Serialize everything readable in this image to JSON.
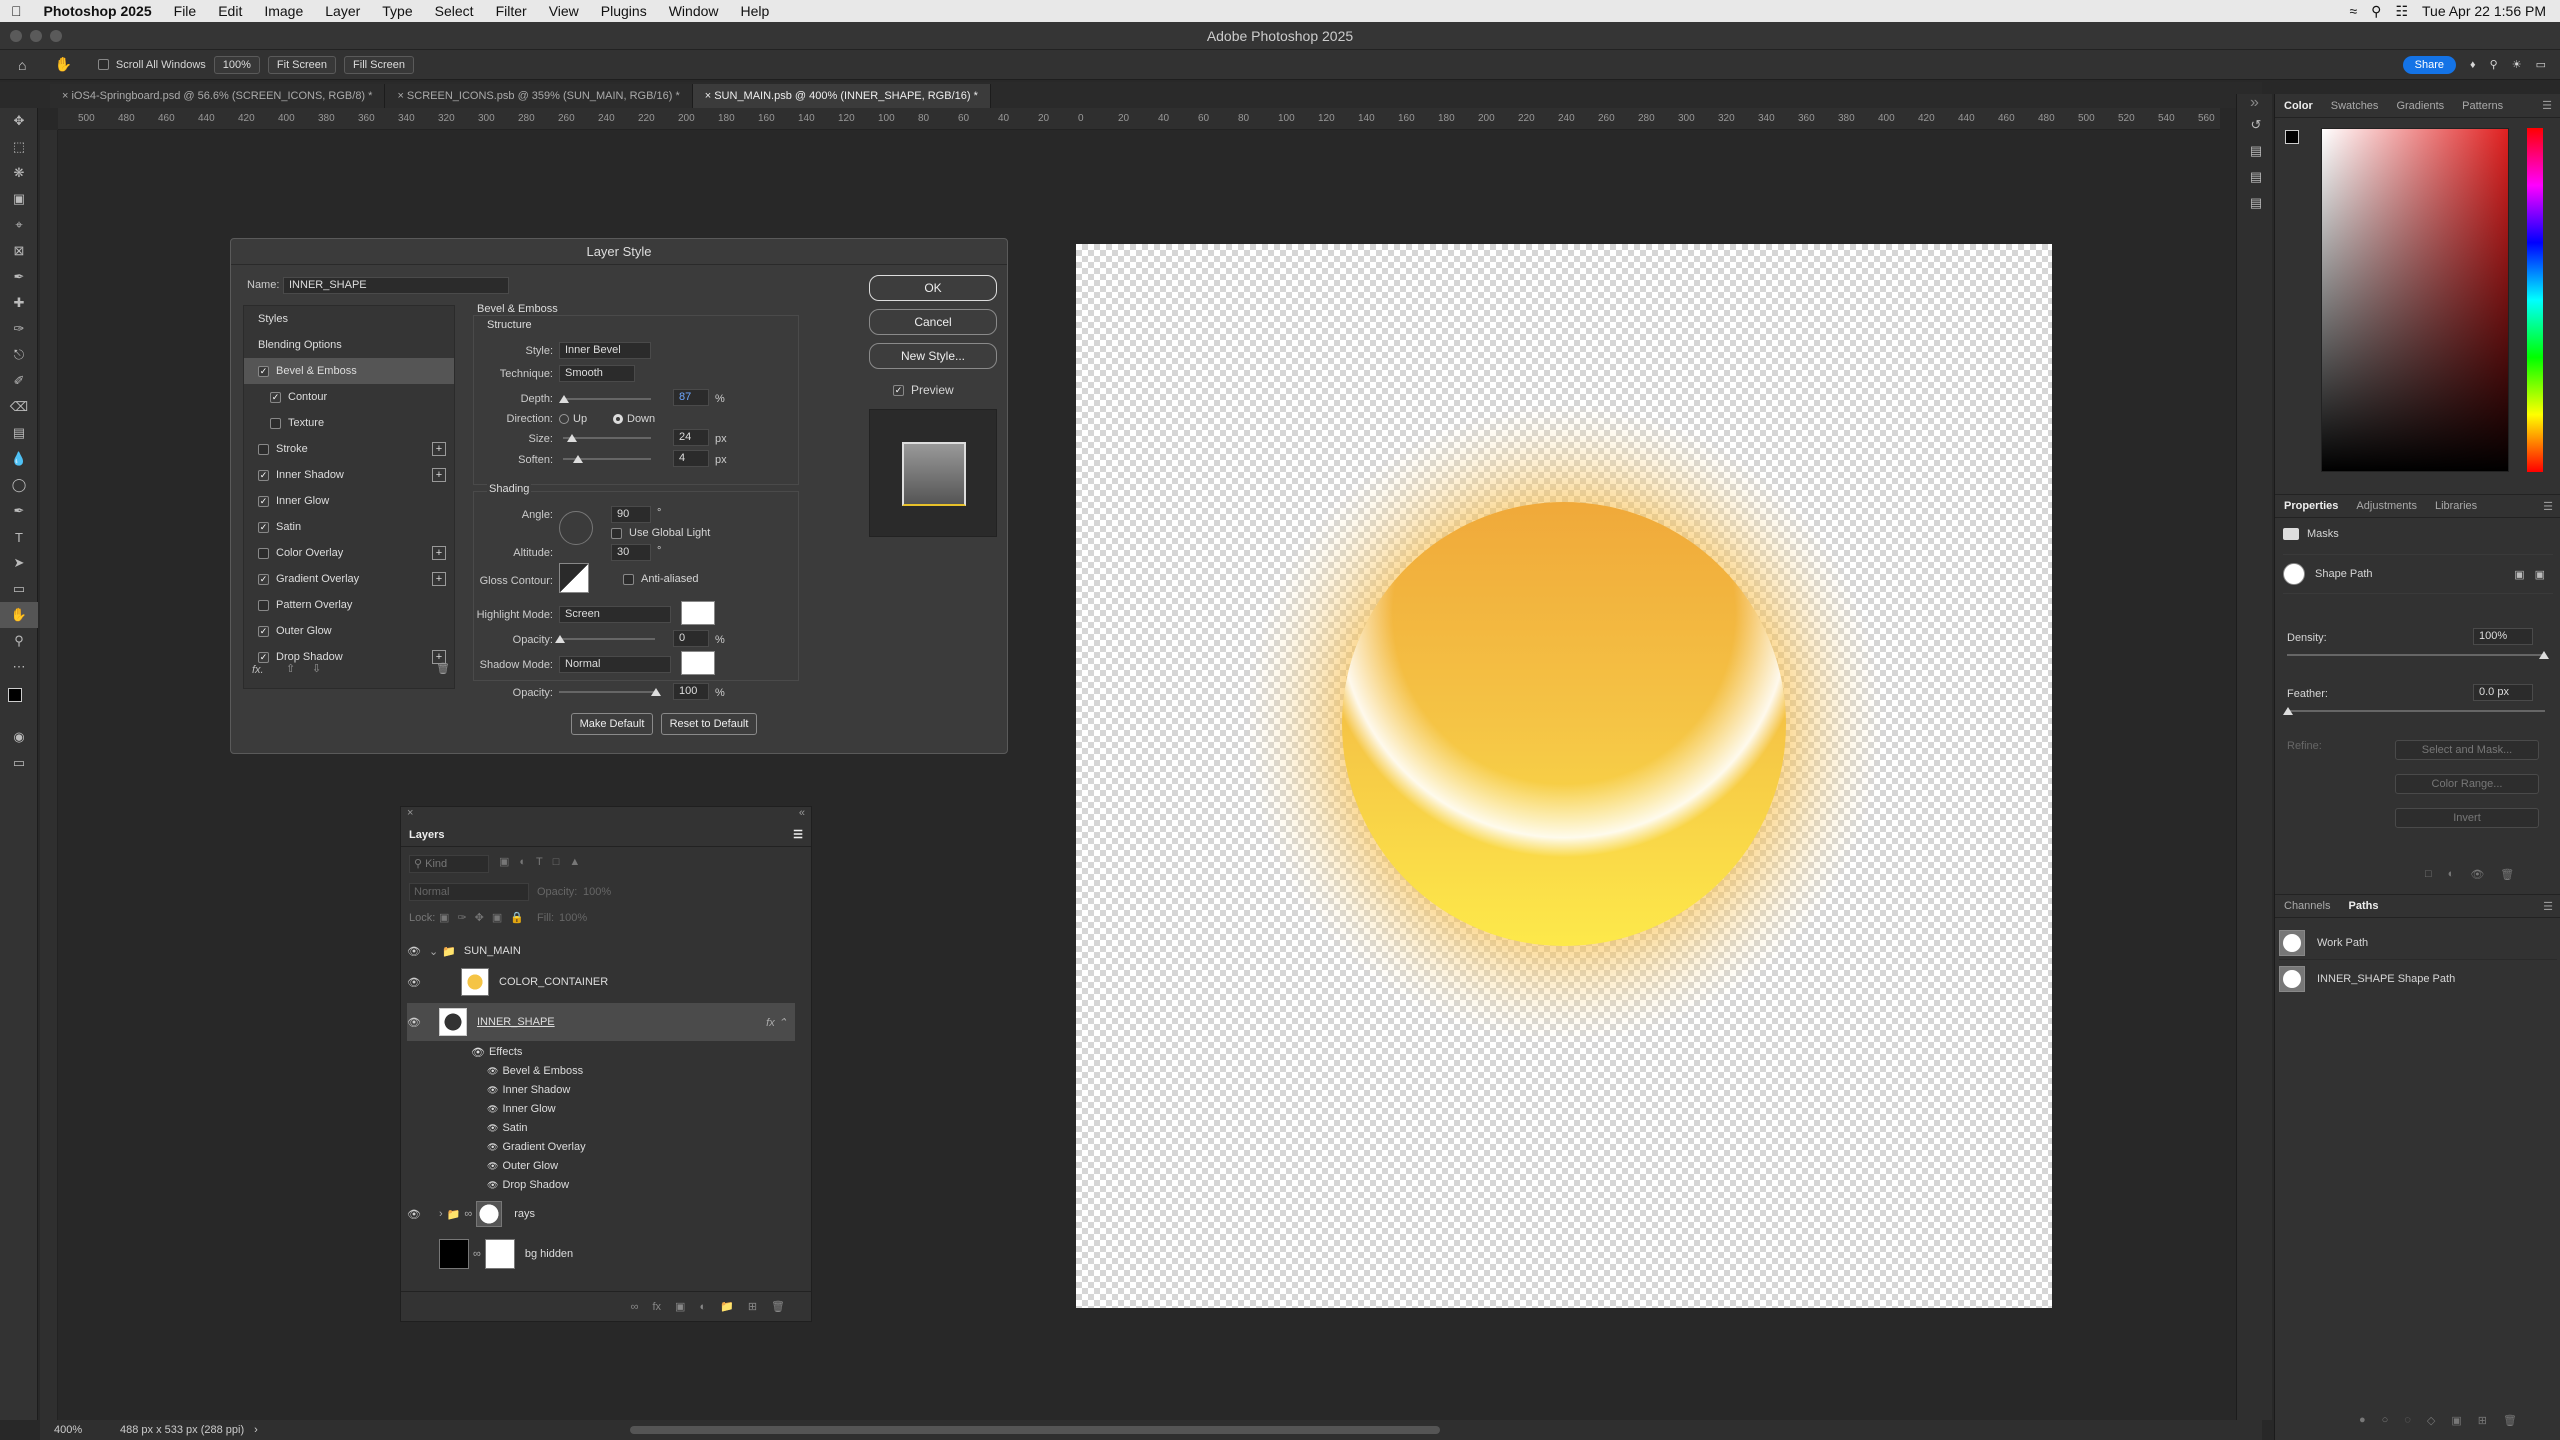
{
  "menubar": {
    "apple": "",
    "app": "Photoshop 2025",
    "items": [
      "File",
      "Edit",
      "Image",
      "Layer",
      "Type",
      "Select",
      "Filter",
      "View",
      "Plugins",
      "Window",
      "Help"
    ],
    "clock": "Tue Apr 22  1:56 PM"
  },
  "window": {
    "title": "Adobe Photoshop 2025",
    "share": "Share"
  },
  "options": {
    "scroll_all": "Scroll All Windows",
    "zoom": "100%",
    "fit": "Fit Screen",
    "fill": "Fill Screen"
  },
  "tabs": [
    {
      "label": "iOS4-Springboard.psd @ 56.6% (SCREEN_ICONS, RGB/8) *"
    },
    {
      "label": "SCREEN_ICONS.psb @ 359% (SUN_MAIN, RGB/16) *"
    },
    {
      "label": "SUN_MAIN.psb @ 400% (INNER_SHAPE, RGB/16) *"
    }
  ],
  "ruler_labels": [
    "500",
    "480",
    "460",
    "440",
    "420",
    "400",
    "380",
    "360",
    "340",
    "320",
    "300",
    "280",
    "260",
    "240",
    "220",
    "200",
    "180",
    "160",
    "140",
    "120",
    "100",
    "80",
    "60",
    "40",
    "20",
    "0",
    "20",
    "40",
    "60",
    "80",
    "100",
    "120",
    "140",
    "160",
    "180",
    "200",
    "220",
    "240",
    "260",
    "280",
    "300",
    "320",
    "340",
    "360",
    "380",
    "400",
    "420",
    "440",
    "460",
    "480",
    "500",
    "520",
    "540",
    "560"
  ],
  "status": {
    "zoom": "400%",
    "doc": "488 px x 533 px (288 ppi)"
  },
  "dialog": {
    "title": "Layer Style",
    "name_label": "Name:",
    "name_value": "INNER_SHAPE",
    "styles_header": "Styles",
    "blending": "Blending Options",
    "styles": [
      {
        "label": "Bevel & Emboss",
        "checked": true,
        "sel": true,
        "plus": false,
        "sub": false
      },
      {
        "label": "Contour",
        "checked": true,
        "sel": false,
        "plus": false,
        "sub": true
      },
      {
        "label": "Texture",
        "checked": false,
        "sel": false,
        "plus": false,
        "sub": true
      },
      {
        "label": "Stroke",
        "checked": false,
        "sel": false,
        "plus": true,
        "sub": false
      },
      {
        "label": "Inner Shadow",
        "checked": true,
        "sel": false,
        "plus": true,
        "sub": false
      },
      {
        "label": "Inner Glow",
        "checked": true,
        "sel": false,
        "plus": false,
        "sub": false
      },
      {
        "label": "Satin",
        "checked": true,
        "sel": false,
        "plus": false,
        "sub": false
      },
      {
        "label": "Color Overlay",
        "checked": false,
        "sel": false,
        "plus": true,
        "sub": false
      },
      {
        "label": "Gradient Overlay",
        "checked": true,
        "sel": false,
        "plus": true,
        "sub": false
      },
      {
        "label": "Pattern Overlay",
        "checked": false,
        "sel": false,
        "plus": false,
        "sub": false
      },
      {
        "label": "Outer Glow",
        "checked": true,
        "sel": false,
        "plus": false,
        "sub": false
      },
      {
        "label": "Drop Shadow",
        "checked": true,
        "sel": false,
        "plus": true,
        "sub": false
      }
    ],
    "fx": "fx.",
    "section": "Bevel & Emboss",
    "structure": "Structure",
    "style_label": "Style:",
    "style_value": "Inner Bevel",
    "technique_label": "Technique:",
    "technique_value": "Smooth",
    "depth_label": "Depth:",
    "depth_value": "87",
    "depth_unit": "%",
    "direction_label": "Direction:",
    "dir_up": "Up",
    "dir_down": "Down",
    "size_label": "Size:",
    "size_value": "24",
    "size_unit": "px",
    "soften_label": "Soften:",
    "soften_value": "4",
    "soften_unit": "px",
    "shading": "Shading",
    "angle_label": "Angle:",
    "angle_value": "90",
    "angle_unit": "°",
    "global_light": "Use Global Light",
    "altitude_label": "Altitude:",
    "altitude_value": "30",
    "altitude_unit": "°",
    "gloss_label": "Gloss Contour:",
    "anti_aliased": "Anti-aliased",
    "highlight_label": "Highlight Mode:",
    "highlight_value": "Screen",
    "opacity_label": "Opacity:",
    "hl_opacity": "0",
    "pct": "%",
    "shadow_label": "Shadow Mode:",
    "shadow_value": "Normal",
    "sh_opacity": "100",
    "make_default": "Make Default",
    "reset_default": "Reset to Default",
    "ok": "OK",
    "cancel": "Cancel",
    "new_style": "New Style...",
    "preview": "Preview"
  },
  "layers": {
    "title": "Layers",
    "kind": "Kind",
    "blend": "Normal",
    "opacity_label": "Opacity:",
    "opacity": "100%",
    "lock": "Lock:",
    "fill_label": "Fill:",
    "fill": "100%",
    "rows": {
      "group": "SUN_MAIN",
      "color": "COLOR_CONTAINER",
      "inner": "INNER_SHAPE",
      "effects": "Effects",
      "rays": "rays",
      "bg": "bg hidden"
    },
    "effects": [
      "Bevel & Emboss",
      "Inner Shadow",
      "Inner Glow",
      "Satin",
      "Gradient Overlay",
      "Outer Glow",
      "Drop Shadow"
    ]
  },
  "panels": {
    "color_tabs": [
      "Color",
      "Swatches",
      "Gradients",
      "Patterns"
    ],
    "props_tabs": [
      "Properties",
      "Adjustments",
      "Libraries"
    ],
    "masks": "Masks",
    "shape_path": "Shape Path",
    "density_label": "Density:",
    "density": "100%",
    "feather_label": "Feather:",
    "feather": "0.0 px",
    "refine": "Refine:",
    "select_mask": "Select and Mask...",
    "color_range": "Color Range...",
    "invert": "Invert",
    "paths_tabs": [
      "Channels",
      "Paths"
    ],
    "paths": [
      "Work Path",
      "INNER_SHAPE Shape Path"
    ]
  }
}
